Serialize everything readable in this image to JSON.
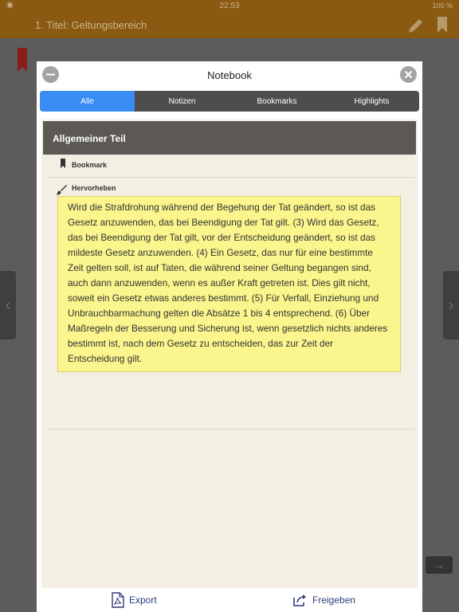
{
  "status_bar": {
    "time": "22:53",
    "battery": "100 %"
  },
  "app_bar": {
    "title": "1. Titel: Geltungsbereich",
    "edit_icon": "pencil-icon",
    "bookmark_icon": "bookmark-icon"
  },
  "notebook": {
    "title": "Notebook",
    "tabs": [
      {
        "label": "Alle",
        "active": true
      },
      {
        "label": "Notizen",
        "active": false
      },
      {
        "label": "Bookmarks",
        "active": false
      },
      {
        "label": "Highlights",
        "active": false
      }
    ],
    "section_title": "Allgemeiner Teil",
    "bookmark_label": "Bookmark",
    "highlight_label": "Hervorheben",
    "highlight_text": "Wird die Strafdrohung während der Begehung der Tat geändert, so ist das Gesetz anzuwenden, das bei Beendigung der Tat gilt. (3) Wird das Gesetz, das bei Beendigung der Tat gilt, vor der Entscheidung geändert, so ist das mildeste Gesetz anzuwenden. (4) Ein Gesetz, das nur für eine bestimmte Zeit gelten soll, ist auf Taten, die während seiner Geltung begangen sind, auch dann anzuwenden, wenn es außer Kraft getreten ist. Dies gilt nicht, soweit ein Gesetz etwas anderes bestimmt. (5) Für Verfall, Einziehung und Unbrauchbarmachung gelten die Absätze 1 bis 4 entsprechend. (6) Über Maßregeln der Besserung und Sicherung ist, wenn gesetzlich nichts anderes bestimmt ist, nach dem Gesetz zu entscheiden, das zur Zeit der Entscheidung gilt.",
    "footer": {
      "export_label": "Export",
      "share_label": "Freigeben"
    }
  },
  "colors": {
    "accent_tab": "#3a8cf5",
    "app_bar": "#8a5a12",
    "highlight": "#faf58c",
    "section_header": "#5c5954"
  }
}
